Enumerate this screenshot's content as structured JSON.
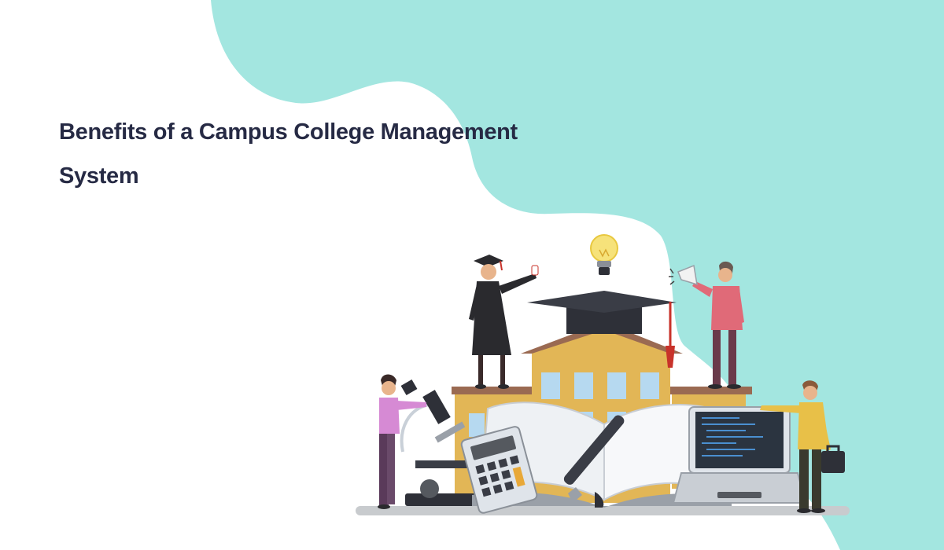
{
  "title": {
    "line1": "Benefits of a Campus College Management",
    "line2": "System"
  },
  "colors": {
    "blob": "#a3e6e0",
    "title_text": "#262a44",
    "building": "#e2b656",
    "roof": "#9a6a52",
    "cap": "#2e3038",
    "tassel": "#c8322a",
    "window": "#b6d9f0",
    "screen": "#2b3440",
    "code_line": "#4a8fd0",
    "book_page": "#eef1f4",
    "ground_shadow": "#c8cbce",
    "person_graduate_robe": "#2a2a2e",
    "person_megaphone_shirt": "#e06a78",
    "person_scientist_shirt": "#d68ad4",
    "person_teacher_shirt": "#e8c048"
  },
  "illustration": {
    "icons": [
      "campus-building-icon",
      "graduation-cap-icon",
      "light-bulb-icon",
      "graduate-student-icon",
      "megaphone-person-icon",
      "scientist-person-icon",
      "teacher-person-icon",
      "microscope-icon",
      "calculator-icon",
      "open-book-icon",
      "fountain-pen-icon",
      "laptop-icon",
      "briefcase-icon"
    ]
  }
}
